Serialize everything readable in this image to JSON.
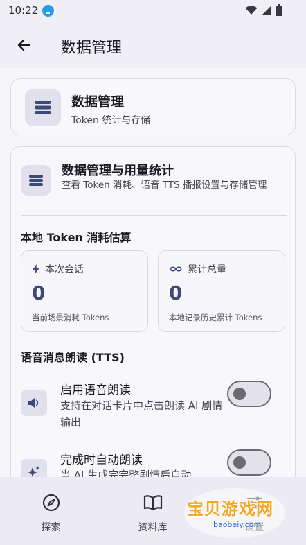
{
  "status_bar": {
    "time": "10:22"
  },
  "app_bar": {
    "title": "数据管理"
  },
  "header_card": {
    "title": "数据管理",
    "subtitle": "Token 统计与存储"
  },
  "main_card": {
    "title": "数据管理与用量统计",
    "description": "查看 Token 消耗、语音 TTS 播报设置与存储管理",
    "token_section": {
      "title": "本地 Token 消耗估算",
      "session": {
        "label": "本次会话",
        "value": "0",
        "footnote": "当前场景消耗 Tokens"
      },
      "total": {
        "label": "累计总量",
        "value": "0",
        "footnote": "本地记录历史累计 Tokens"
      }
    },
    "tts_section": {
      "title": "语音消息朗读 (TTS)",
      "settings": [
        {
          "title": "启用语音朗读",
          "description": "支持在对话卡片中点击朗读 AI 剧情输出",
          "enabled": false
        },
        {
          "title": "完成时自动朗读",
          "description": "当 AI 生成完完整剧情后自动",
          "enabled": false
        }
      ]
    }
  },
  "bottom_nav": [
    {
      "label": "探索",
      "icon": "compass-icon"
    },
    {
      "label": "资料库",
      "icon": "book-icon"
    },
    {
      "label": "设置",
      "icon": "sliders-icon"
    }
  ],
  "watermark": {
    "text": "宝贝游戏网",
    "url": "baobeiy.com"
  }
}
